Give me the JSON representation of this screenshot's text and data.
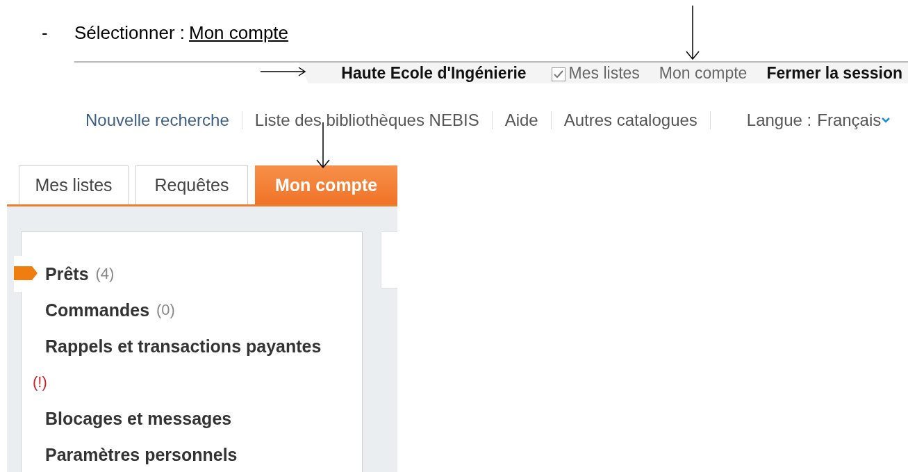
{
  "instruction": {
    "bullet": "-",
    "label": "Sélectionner :",
    "link": "Mon compte"
  },
  "top_bar": {
    "institution": "Haute Ecole d'Ingénierie",
    "items": [
      {
        "kind": "checkbox",
        "label": "Mes listes",
        "checked": true
      },
      {
        "kind": "link",
        "label": "Mon compte"
      },
      {
        "kind": "strong",
        "label": "Fermer la session"
      }
    ]
  },
  "nav": {
    "links": [
      {
        "kind": "primary",
        "label": "Nouvelle recherche"
      },
      {
        "kind": "plain",
        "label": "Liste des bibliothèques NEBIS"
      },
      {
        "kind": "plain",
        "label": "Aide"
      },
      {
        "kind": "plain",
        "label": "Autres catalogues"
      }
    ],
    "language": {
      "label": "Langue :",
      "value": "Français"
    }
  },
  "tabs": [
    {
      "label": "Mes listes",
      "selected": false
    },
    {
      "label": "Requêtes",
      "selected": false
    },
    {
      "label": "Mon compte",
      "selected": true
    }
  ],
  "menu": [
    {
      "label": "Prêts",
      "count": "(4)",
      "selected": true
    },
    {
      "label": "Commandes",
      "count": "(0)",
      "selected": false
    },
    {
      "label": "Rappels et transactions payantes",
      "alert": "(!)",
      "selected": false
    },
    {
      "label": "Blocages et messages",
      "selected": false
    },
    {
      "label": "Paramètres personnels",
      "selected": false
    }
  ]
}
